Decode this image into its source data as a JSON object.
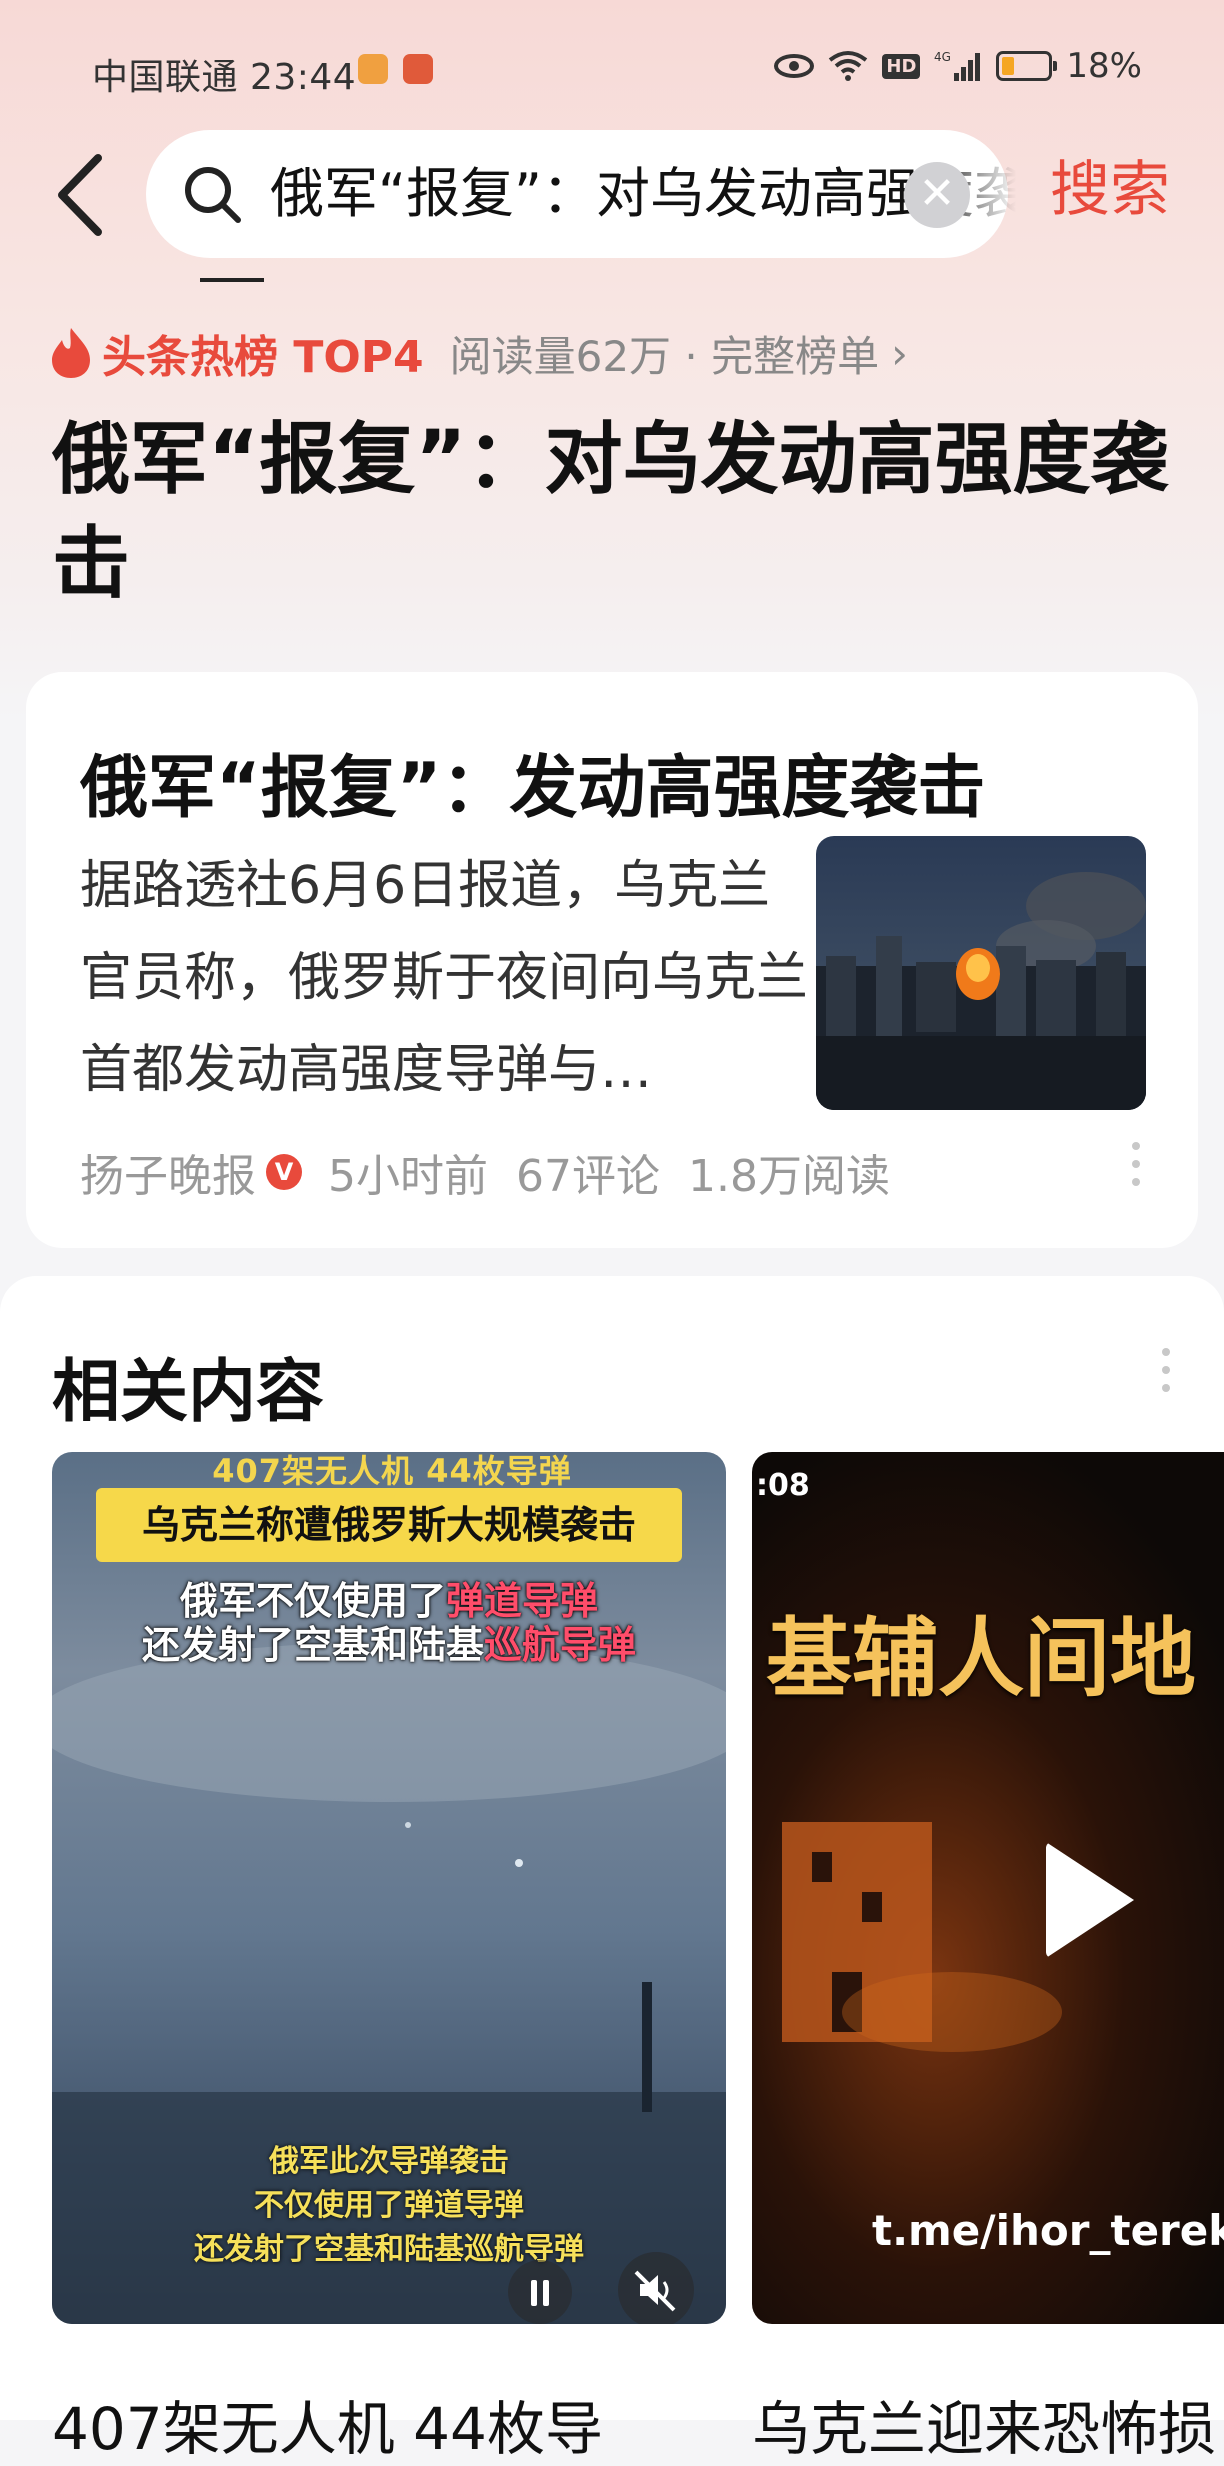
{
  "status_bar": {
    "carrier_time": "中国联通 23:44",
    "network": "4G",
    "hd": "HD",
    "battery": "18%"
  },
  "search": {
    "query": "俄军“报复”：对乌发动高强度袭击",
    "button": "搜索"
  },
  "hot_rank": {
    "label": "头条热榜 TOP4",
    "meta": "阅读量62万 · 完整榜单",
    "headline": "俄军“报复”：对乌发动高强度袭击"
  },
  "article": {
    "title": "俄军“报复”：发动高强度袭击",
    "summary": "据路透社6月6日报道，乌克兰官员称，俄罗斯于夜间向乌克兰首都发动高强度导弹与…",
    "source": "扬子晚报",
    "verified_badge": "V",
    "time": "5小时前",
    "comments": "67评论",
    "reads": "1.8万阅读"
  },
  "related": {
    "title": "相关内容",
    "video1": {
      "banner_top": "407架无人机 44枚导弹",
      "banner": "乌克兰称遭俄罗斯大规模袭击",
      "line1_a": "俄军不仅使用了",
      "line1_b": "弹道导弹",
      "line2_a": "还发射了空基和陆基",
      "line2_b": "巡航导弹",
      "bottom1": "俄军此次导弹袭击",
      "bottom2": "不仅使用了弹道导弹",
      "bottom3": "还发射了空基和陆基巡航导弹",
      "caption": "407架无人机 44枚导"
    },
    "video2": {
      "time": ":08",
      "title": "基辅人间地",
      "watermark": "t.me/ihor_terekh",
      "caption": "乌克兰迎来恐怖损"
    }
  },
  "colors": {
    "accent": "#e84a3c",
    "banner_yellow": "#f6d84a",
    "highlight_pink": "#ff4d6a"
  }
}
